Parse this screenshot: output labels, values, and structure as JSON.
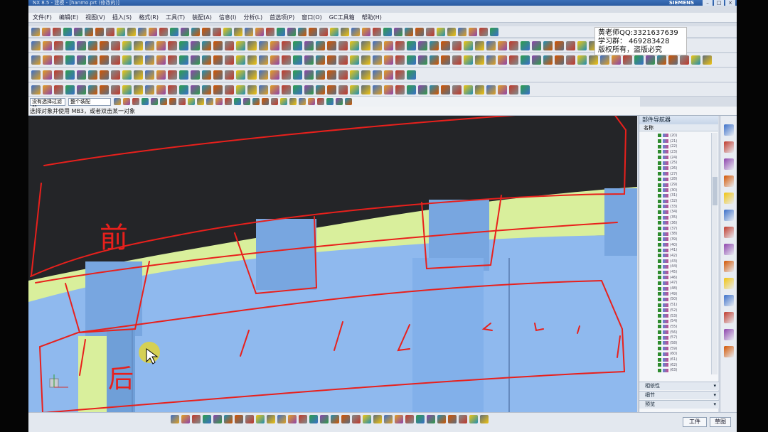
{
  "window": {
    "title": "NX 8.5 - 建模 - [hanmo.prt (修改的)]",
    "brand": "SIEMENS",
    "controls": [
      "–",
      "□",
      "×"
    ]
  },
  "menu": {
    "items": [
      "文件(F)",
      "编辑(E)",
      "视图(V)",
      "插入(S)",
      "格式(R)",
      "工具(T)",
      "装配(A)",
      "信息(I)",
      "分析(L)",
      "首选项(P)",
      "窗口(O)",
      "GC工具箱",
      "帮助(H)"
    ]
  },
  "notice": {
    "line1": "黄老师QQ:3321637639",
    "line2": "学习群：  469283428",
    "line3": "版权所有，盗版必究"
  },
  "selection": {
    "filter": "没有选择过滤器",
    "scope": "整个装配"
  },
  "cue_line": "选择对象并使用 MB3，或者双击某一对象",
  "part_navigator": {
    "title": "部件导航器",
    "column": "名称",
    "rows": [
      "(20)",
      "(21)",
      "(22)",
      "(23)",
      "(24)",
      "(25)",
      "(26)",
      "(27)",
      "(28)",
      "(29)",
      "(30)",
      "(31)",
      "(32)",
      "(33)",
      "(34)",
      "(35)",
      "(36)",
      "(37)",
      "(38)",
      "(39)",
      "(40)",
      "(41)",
      "(42)",
      "(43)",
      "(44)",
      "(45)",
      "(46)",
      "(47)",
      "(48)",
      "(49)",
      "(50)",
      "(51)",
      "(52)",
      "(53)",
      "(54)",
      "(55)",
      "(56)",
      "(57)",
      "(58)",
      "(59)",
      "(60)",
      "(61)",
      "(62)",
      "(63)"
    ],
    "sections": [
      "相依性",
      "细节",
      "预览"
    ]
  },
  "annotations": {
    "front": "前",
    "back": "后"
  },
  "bottom": {
    "left_button": "工件",
    "right_button": "草图"
  },
  "colors": {
    "background": "#222427",
    "face_green": "#d9ef9c",
    "face_blue": "#8fb9ee",
    "pocket_blue": "#6f9fd8",
    "markup_red": "#e8201c"
  }
}
